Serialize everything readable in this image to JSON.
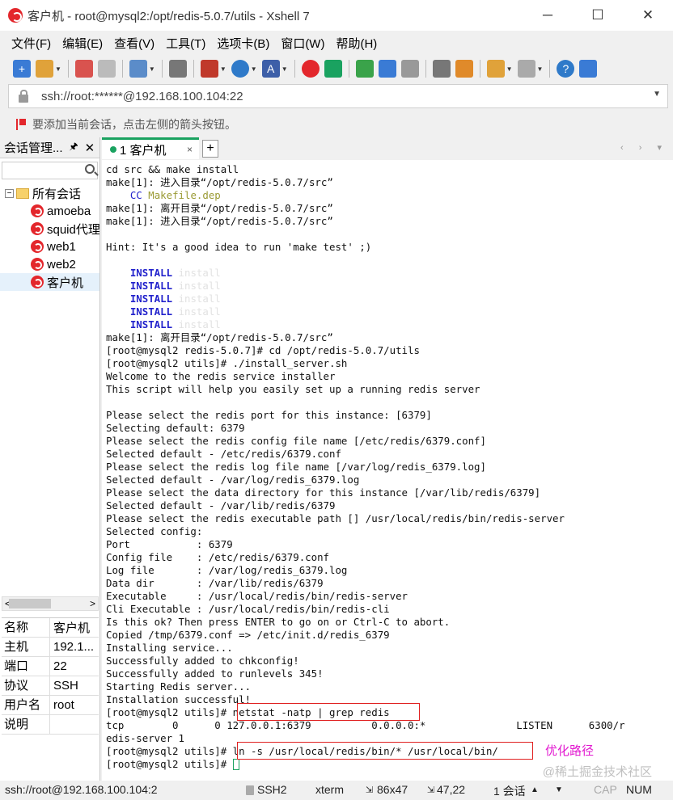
{
  "window": {
    "title": "客户机 - root@mysql2:/opt/redis-5.0.7/utils - Xshell 7",
    "minimize": "─",
    "maximize": "☐",
    "close": "✕"
  },
  "menu": [
    "文件(F)",
    "编辑(E)",
    "查看(V)",
    "工具(T)",
    "选项卡(B)",
    "窗口(W)",
    "帮助(H)"
  ],
  "address": {
    "value": "ssh://root:******@192.168.100.104:22"
  },
  "hint": "要添加当前会话，点击左侧的箭头按钮。",
  "session_panel": {
    "title": "会话管理...",
    "pin": "🖈",
    "close": "✕",
    "root": "所有会话",
    "root_toggle": "−",
    "items": [
      "amoeba",
      "squid代理",
      "web1",
      "web2",
      "客户机"
    ],
    "scroll_left": "<",
    "scroll_right": ">"
  },
  "properties": [
    {
      "key": "名称",
      "value": "客户机"
    },
    {
      "key": "主机",
      "value": "192.1..."
    },
    {
      "key": "端口",
      "value": "22"
    },
    {
      "key": "协议",
      "value": "SSH"
    },
    {
      "key": "用户名",
      "value": "root"
    },
    {
      "key": "说明",
      "value": ""
    }
  ],
  "tab": {
    "label": "1 客户机",
    "close": "×",
    "add": "+",
    "nav": "‹ › ▾"
  },
  "terminal": {
    "lines": [
      "cd src && make install",
      "make[1]: 进入目录“/opt/redis-5.0.7/src”",
      "make[1]: 离开目录“/opt/redis-5.0.7/src”",
      "make[1]: 进入目录“/opt/redis-5.0.7/src”",
      "",
      "Hint: It's a good idea to run 'make test' ;)",
      "",
      "make[1]: 离开目录“/opt/redis-5.0.7/src”",
      "[root@mysql2 redis-5.0.7]# cd /opt/redis-5.0.7/utils",
      "[root@mysql2 utils]# ./install_server.sh",
      "Welcome to the redis service installer",
      "This script will help you easily set up a running redis server",
      "",
      "Please select the redis port for this instance: [6379]",
      "Selecting default: 6379",
      "Please select the redis config file name [/etc/redis/6379.conf]",
      "Selected default - /etc/redis/6379.conf",
      "Please select the redis log file name [/var/log/redis_6379.log]",
      "Selected default - /var/log/redis_6379.log",
      "Please select the data directory for this instance [/var/lib/redis/6379]",
      "Selected default - /var/lib/redis/6379",
      "Please select the redis executable path [] /usr/local/redis/bin/redis-server",
      "Selected config:",
      "Port           : 6379",
      "Config file    : /etc/redis/6379.conf",
      "Log file       : /var/log/redis_6379.log",
      "Data dir       : /var/lib/redis/6379",
      "Executable     : /usr/local/redis/bin/redis-server",
      "Cli Executable : /usr/local/redis/bin/redis-cli",
      "Is this ok? Then press ENTER to go on or Ctrl-C to abort.",
      "Copied /tmp/6379.conf => /etc/init.d/redis_6379",
      "Installing service...",
      "Successfully added to chkconfig!",
      "Successfully added to runlevels 345!",
      "Starting Redis server...",
      "Installation successful!",
      "tcp        0      0 127.0.0.1:6379          0.0.0.0:*               LISTEN      6300/r",
      "edis-server 1"
    ],
    "cc_prefix": "CC",
    "cc_target": "Makefile.dep",
    "install_keyword": "INSTALL",
    "install_ghost": "install",
    "prompt": "[root@mysql2 utils]# ",
    "cmd_netstat": "netstat -natp | grep redis",
    "cmd_ln": "ln -s /usr/local/redis/bin/* /usr/local/bin/",
    "annotation": "优化路径"
  },
  "watermark": "@稀土掘金技术社区",
  "status": {
    "address": "ssh://root@192.168.100.104:2",
    "protocol": "SSH2",
    "term": "xterm",
    "size": "86x47",
    "cursor": "47,22",
    "sessions": "1 会话",
    "caps": "CAP",
    "num": "NUM",
    "arrow_up": "▲",
    "arrow_down": "▼"
  },
  "colors": {
    "brand_red": "#e3272c",
    "tab_green": "#1aa260",
    "highlight_box": "#e02020",
    "annotation": "#e21ad0",
    "command_blue": "#2222cc"
  }
}
